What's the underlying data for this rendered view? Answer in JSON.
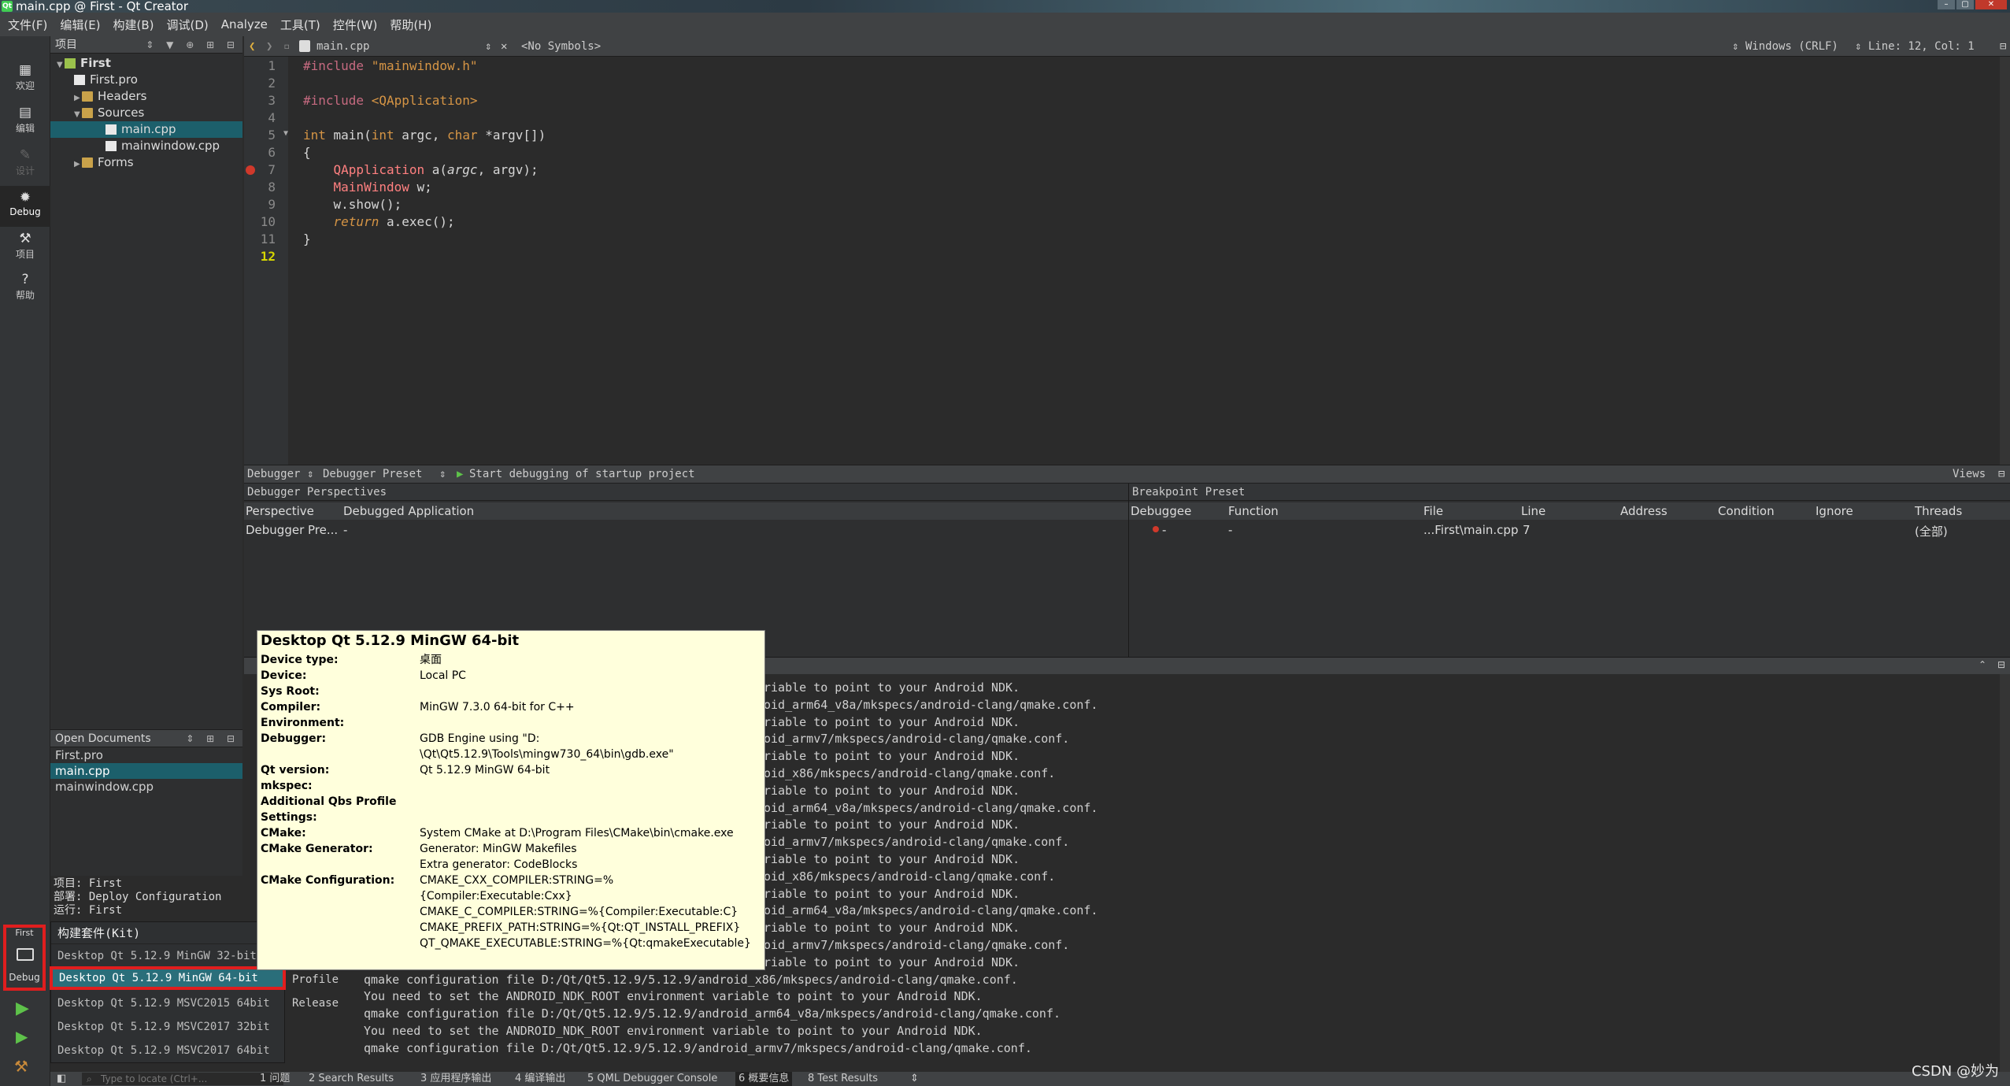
{
  "window": {
    "title": "main.cpp @ First - Qt Creator"
  },
  "menu": [
    "文件(F)",
    "编辑(E)",
    "构建(B)",
    "调试(D)",
    "Analyze",
    "工具(T)",
    "控件(W)",
    "帮助(H)"
  ],
  "modes": [
    {
      "label": "欢迎",
      "icon": "welcome-icon"
    },
    {
      "label": "编辑",
      "icon": "edit-icon"
    },
    {
      "label": "设计",
      "icon": "design-icon"
    },
    {
      "label": "Debug",
      "icon": "debug-icon"
    },
    {
      "label": "项目",
      "icon": "projects-icon"
    },
    {
      "label": "帮助",
      "icon": "help-icon"
    }
  ],
  "project_panel": {
    "header": "项目",
    "tree": [
      {
        "label": "First",
        "depth": 0,
        "type": "proj",
        "expanded": true
      },
      {
        "label": "First.pro",
        "depth": 1,
        "type": "file"
      },
      {
        "label": "Headers",
        "depth": 1,
        "type": "folder",
        "collapsed": true
      },
      {
        "label": "Sources",
        "depth": 1,
        "type": "folder",
        "expanded": true
      },
      {
        "label": "main.cpp",
        "depth": 2,
        "type": "file",
        "selected": true
      },
      {
        "label": "mainwindow.cpp",
        "depth": 2,
        "type": "file"
      },
      {
        "label": "Forms",
        "depth": 1,
        "type": "folder",
        "collapsed": true
      }
    ]
  },
  "open_documents": {
    "header": "Open Documents",
    "docs": [
      {
        "label": "First.pro"
      },
      {
        "label": "main.cpp",
        "selected": true
      },
      {
        "label": "mainwindow.cpp"
      }
    ]
  },
  "editor": {
    "file_tab": "main.cpp",
    "symbols": "<No Symbols>",
    "line_ending": "Windows (CRLF)",
    "position": "Line: 12, Col: 1",
    "line_numbers": [
      "1",
      "2",
      "3",
      "4",
      "5",
      "6",
      "7",
      "8",
      "9",
      "10",
      "11",
      "12"
    ],
    "current_line": "12",
    "breakpoint_line": "7"
  },
  "debugger": {
    "selector": "Debugger",
    "preset": "Debugger Preset",
    "start_label": "Start debugging of startup project",
    "views": "Views",
    "perspectives_title": "Debugger Perspectives",
    "perspective_cols": [
      "Perspective",
      "Debugged Application"
    ],
    "perspective_row": [
      "Debugger Pre...",
      "-"
    ],
    "breakpoint_title": "Breakpoint Preset",
    "bp_cols": [
      "Debuggee",
      "Function",
      "File",
      "Line",
      "Address",
      "Condition",
      "Ignore",
      "Threads"
    ],
    "bp_row": [
      "-",
      "-",
      "...First\\main.cpp",
      "7",
      "",
      "",
      "",
      "(全部)"
    ]
  },
  "output_lines": [
    "riable to point to your Android NDK.",
    "oid_arm64_v8a/mkspecs/android-clang/qmake.conf.",
    "riable to point to your Android NDK.",
    "oid_armv7/mkspecs/android-clang/qmake.conf.",
    "riable to point to your Android NDK.",
    "oid_x86/mkspecs/android-clang/qmake.conf.",
    "riable to point to your Android NDK.",
    "oid_arm64_v8a/mkspecs/android-clang/qmake.conf.",
    "riable to point to your Android NDK.",
    "oid_armv7/mkspecs/android-clang/qmake.conf.",
    "riable to point to your Android NDK.",
    "oid_x86/mkspecs/android-clang/qmake.conf.",
    "riable to point to your Android NDK.",
    "oid_arm64_v8a/mkspecs/android-clang/qmake.conf.",
    "riable to point to your Android NDK.",
    "oid_armv7/mkspecs/android-clang/qmake.conf.",
    "riable to point to your Android NDK.",
    "qmake configuration file D:/Qt/Qt5.12.9/5.12.9/android_x86/mkspecs/android-clang/qmake.conf.",
    "You need to set the ANDROID_NDK_ROOT environment variable to point to your Android NDK.",
    "qmake configuration file D:/Qt/Qt5.12.9/5.12.9/android_arm64_v8a/mkspecs/android-clang/qmake.conf.",
    "You need to set the ANDROID_NDK_ROOT environment variable to point to your Android NDK.",
    "qmake configuration file D:/Qt/Qt5.12.9/5.12.9/android_armv7/mkspecs/android-clang/qmake.conf."
  ],
  "kit_info": [
    "项目: First",
    "部署: Deploy Configuration",
    "运行: First"
  ],
  "target_selector": {
    "name": "First",
    "label": "Debug"
  },
  "kit_popup": {
    "header": "构建套件(Kit)",
    "kits": [
      "Desktop Qt 5.12.9 MinGW 32-bit",
      "Desktop Qt 5.12.9 MinGW 64-bit",
      "Desktop Qt 5.12.9 MSVC2015 64bit",
      "Desktop Qt 5.12.9 MSVC2017 32bit",
      "Desktop Qt 5.12.9 MSVC2017 64bit"
    ],
    "selected_index": 1,
    "build_types": [
      "Profile",
      "Release"
    ]
  },
  "tooltip": {
    "title": "Desktop Qt 5.12.9 MinGW 64-bit",
    "rows": [
      {
        "k": "Device type:",
        "v": "桌面"
      },
      {
        "k": "Device:",
        "v": "Local PC"
      },
      {
        "k": "Sys Root:",
        "v": ""
      },
      {
        "k": "Compiler:",
        "v": "MinGW 7.3.0 64-bit for C++"
      },
      {
        "k": "Environment:",
        "v": ""
      },
      {
        "k": "Debugger:",
        "v": "GDB Engine using \"D:\n\\Qt\\Qt5.12.9\\Tools\\mingw730_64\\bin\\gdb.exe\""
      },
      {
        "k": "Qt version:",
        "v": "Qt 5.12.9 MinGW 64-bit"
      },
      {
        "k": "mkspec:",
        "v": ""
      },
      {
        "k": "Additional Qbs Profile\nSettings:",
        "v": ""
      },
      {
        "k": "CMake:",
        "v": "System CMake at D:\\Program Files\\CMake\\bin\\cmake.exe"
      },
      {
        "k": "CMake Generator:",
        "v": "Generator: MinGW Makefiles\nExtra generator: CodeBlocks"
      },
      {
        "k": "CMake Configuration:",
        "v": "CMAKE_CXX_COMPILER:STRING=%\n{Compiler:Executable:Cxx}\nCMAKE_C_COMPILER:STRING=%{Compiler:Executable:C}\nCMAKE_PREFIX_PATH:STRING=%{Qt:QT_INSTALL_PREFIX}\nQT_QMAKE_EXECUTABLE:STRING=%{Qt:qmakeExecutable}"
      }
    ]
  },
  "statusbar": {
    "locator_placeholder": "Type to locate (Ctrl+...",
    "tabs": [
      "1 问题",
      "2 Search Results",
      "3 应用程序输出",
      "4 编译输出",
      "5 QML Debugger Console",
      "6 概要信息",
      "8 Test Results"
    ]
  },
  "watermark": "CSDN @妙为"
}
